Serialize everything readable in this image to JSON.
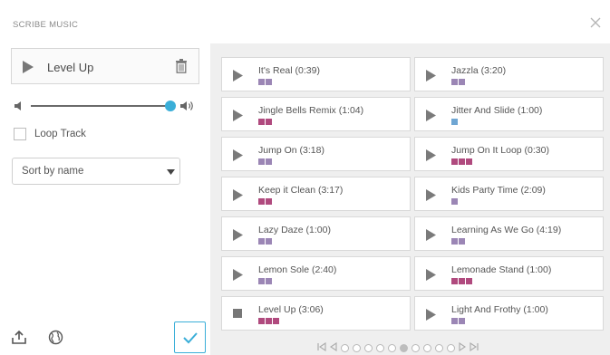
{
  "app": {
    "title": "SCRIBE MUSIC"
  },
  "now_playing": {
    "title": "Level Up"
  },
  "volume": {
    "level": 1.0
  },
  "loop": {
    "label": "Loop Track",
    "checked": false
  },
  "sort": {
    "selected": "Sort by name"
  },
  "colors": {
    "accent": "#3aaed8",
    "purple": "#9b86b5",
    "magenta": "#b04a7e",
    "blue": "#6fa6d3"
  },
  "tracks": [
    {
      "title": "It's Real (0:39)",
      "tags": [
        "#9b86b5",
        "#9b86b5"
      ],
      "icon": "play-icon"
    },
    {
      "title": "Jazzla (3:20)",
      "tags": [
        "#9b86b5",
        "#9b86b5"
      ],
      "icon": "play-icon"
    },
    {
      "title": "Jingle Bells Remix (1:04)",
      "tags": [
        "#b04a7e",
        "#b04a7e"
      ],
      "icon": "play-icon"
    },
    {
      "title": "Jitter And Slide (1:00)",
      "tags": [
        "#6fa6d3"
      ],
      "icon": "play-icon"
    },
    {
      "title": "Jump On (3:18)",
      "tags": [
        "#9b86b5",
        "#9b86b5"
      ],
      "icon": "play-icon"
    },
    {
      "title": "Jump On It Loop (0:30)",
      "tags": [
        "#b04a7e",
        "#b04a7e",
        "#b04a7e"
      ],
      "icon": "play-icon"
    },
    {
      "title": "Keep it Clean (3:17)",
      "tags": [
        "#b04a7e",
        "#b04a7e"
      ],
      "icon": "play-icon"
    },
    {
      "title": "Kids Party Time (2:09)",
      "tags": [
        "#9b86b5"
      ],
      "icon": "play-icon"
    },
    {
      "title": "Lazy Daze (1:00)",
      "tags": [
        "#9b86b5",
        "#9b86b5"
      ],
      "icon": "play-icon"
    },
    {
      "title": "Learning As We Go (4:19)",
      "tags": [
        "#9b86b5",
        "#9b86b5"
      ],
      "icon": "play-icon"
    },
    {
      "title": "Lemon Sole (2:40)",
      "tags": [
        "#9b86b5",
        "#9b86b5"
      ],
      "icon": "play-icon"
    },
    {
      "title": "Lemonade Stand (1:00)",
      "tags": [
        "#b04a7e",
        "#b04a7e",
        "#b04a7e"
      ],
      "icon": "play-icon"
    },
    {
      "title": "Level Up (3:06)",
      "tags": [
        "#b04a7e",
        "#b04a7e",
        "#b04a7e"
      ],
      "icon": "stop-icon"
    },
    {
      "title": "Light And Frothy (1:00)",
      "tags": [
        "#9b86b5",
        "#9b86b5"
      ],
      "icon": "play-icon"
    }
  ],
  "pagination": {
    "pages": 10,
    "current": 6
  }
}
